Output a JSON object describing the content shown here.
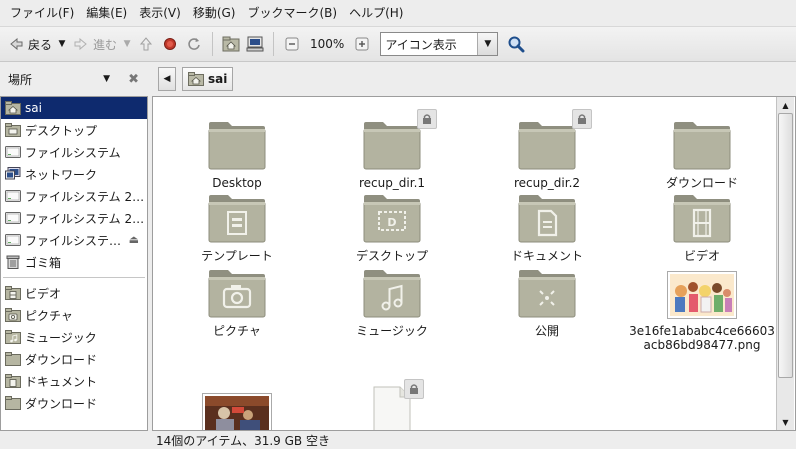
{
  "menu": [
    "ファイル(F)",
    "編集(E)",
    "表示(V)",
    "移動(G)",
    "ブックマーク(B)",
    "ヘルプ(H)"
  ],
  "toolbar": {
    "back_label": "戻る",
    "forward_label": "進む",
    "zoom_level": "100%",
    "view_mode": "アイコン表示"
  },
  "sidebar": {
    "title": "場所",
    "items": [
      {
        "label": "sai",
        "icon": "home-folder-icon"
      },
      {
        "label": "デスクトップ",
        "icon": "desktop-folder-icon"
      },
      {
        "label": "ファイルシステム",
        "icon": "drive-icon"
      },
      {
        "label": "ネットワーク",
        "icon": "network-icon"
      },
      {
        "label": "ファイルシステム 2…",
        "icon": "drive-icon"
      },
      {
        "label": "ファイルシステム 2…",
        "icon": "drive-icon"
      },
      {
        "label": "ファイルシステ…",
        "icon": "drive-icon"
      },
      {
        "label": "ゴミ箱",
        "icon": "trash-icon"
      }
    ],
    "bookmarks": [
      {
        "label": "ビデオ",
        "icon": "video-folder-icon"
      },
      {
        "label": "ピクチャ",
        "icon": "pictures-folder-icon"
      },
      {
        "label": "ミュージック",
        "icon": "music-folder-icon"
      },
      {
        "label": "ダウンロード",
        "icon": "folder-icon"
      },
      {
        "label": "ドキュメント",
        "icon": "documents-folder-icon"
      },
      {
        "label": "ダウンロード",
        "icon": "folder-icon"
      }
    ]
  },
  "location": {
    "crumb": "sai"
  },
  "files": [
    {
      "name": "Desktop",
      "icon": "folder-icon"
    },
    {
      "name": "recup_dir.1",
      "icon": "folder-icon",
      "locked": true
    },
    {
      "name": "recup_dir.2",
      "icon": "folder-icon",
      "locked": true
    },
    {
      "name": "ダウンロード",
      "icon": "folder-icon"
    },
    {
      "name": "テンプレート",
      "icon": "templates-folder-icon"
    },
    {
      "name": "デスクトップ",
      "icon": "desktop-folder-icon"
    },
    {
      "name": "ドキュメント",
      "icon": "documents-folder-icon"
    },
    {
      "name": "ビデオ",
      "icon": "video-folder-icon"
    },
    {
      "name": "ピクチャ",
      "icon": "pictures-folder-icon"
    },
    {
      "name": "ミュージック",
      "icon": "music-folder-icon"
    },
    {
      "name": "公開",
      "icon": "public-folder-icon"
    },
    {
      "name": "3e16fe1ababc4ce66603acb86bd98477.png",
      "icon": "image-thumbnail"
    },
    {
      "name": "",
      "icon": "image-thumbnail"
    },
    {
      "name": "",
      "icon": "document-icon",
      "locked": true
    }
  ],
  "status": "14個のアイテム、31.9 GB 空き"
}
